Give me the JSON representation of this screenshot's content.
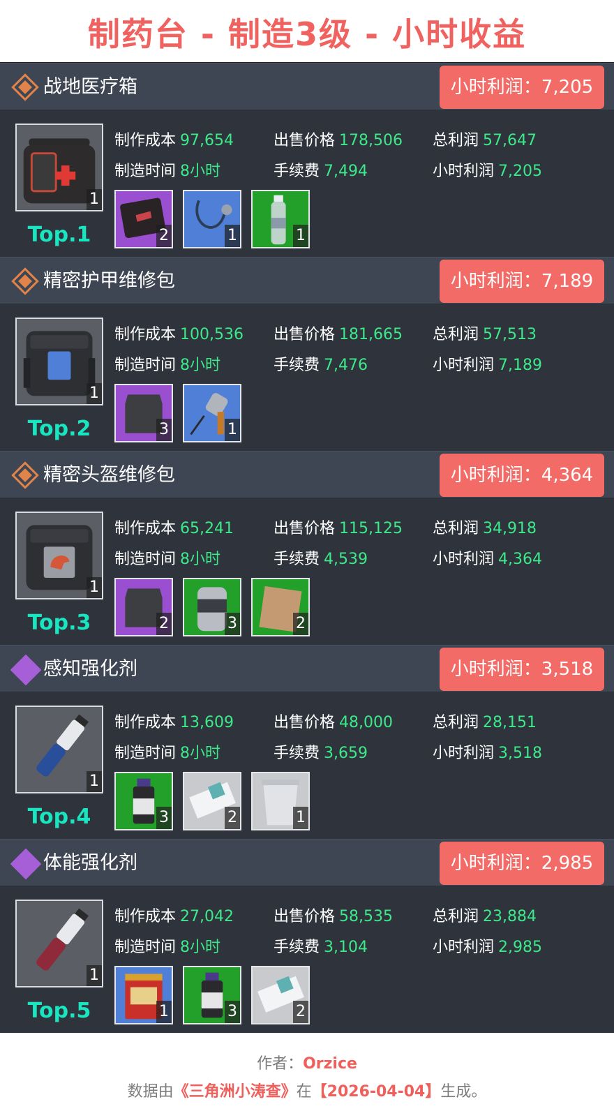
{
  "title": "制药台 - 制造3级 - 小时收益",
  "labels": {
    "cost": "制作成本",
    "time": "制造时间",
    "price": "出售价格",
    "fee": "手续费",
    "total": "总利润",
    "hourly": "小时利润"
  },
  "items": [
    {
      "name": "战地医疗箱",
      "hour_badge": "小时利润：7,205",
      "rank": "Top.1",
      "main_qty": "1",
      "cost": "97,654",
      "time": "8小时",
      "price": "178,506",
      "fee": "7,494",
      "total": "57,647",
      "hourly": "7,205",
      "materials": [
        {
          "qty": "2",
          "icon": "ifak-pouch-icon"
        },
        {
          "qty": "1",
          "icon": "stethoscope-icon"
        },
        {
          "qty": "1",
          "icon": "water-bottle-icon"
        }
      ]
    },
    {
      "name": "精密护甲维修包",
      "hour_badge": "小时利润：7,189",
      "rank": "Top.2",
      "main_qty": "1",
      "cost": "100,536",
      "time": "8小时",
      "price": "181,665",
      "fee": "7,476",
      "total": "57,513",
      "hourly": "7,189",
      "materials": [
        {
          "qty": "3",
          "icon": "armor-plate-icon"
        },
        {
          "qty": "1",
          "icon": "power-drill-icon"
        }
      ]
    },
    {
      "name": "精密头盔维修包",
      "hour_badge": "小时利润：4,364",
      "rank": "Top.3",
      "main_qty": "1",
      "cost": "65,241",
      "time": "8小时",
      "price": "115,125",
      "fee": "4,539",
      "total": "34,918",
      "hourly": "4,364",
      "materials": [
        {
          "qty": "2",
          "icon": "armor-plate-icon"
        },
        {
          "qty": "3",
          "icon": "gas-canister-icon"
        },
        {
          "qty": "2",
          "icon": "wood-plank-icon"
        }
      ]
    },
    {
      "name": "感知强化剂",
      "hour_badge": "小时利润：3,518",
      "rank": "Top.4",
      "main_qty": "1",
      "cost": "13,609",
      "time": "8小时",
      "price": "48,000",
      "fee": "3,659",
      "total": "28,151",
      "hourly": "3,518",
      "materials": [
        {
          "qty": "3",
          "icon": "medicine-vial-icon"
        },
        {
          "qty": "2",
          "icon": "test-strip-icon"
        },
        {
          "qty": "1",
          "icon": "yogurt-cup-icon"
        }
      ]
    },
    {
      "name": "体能强化剂",
      "hour_badge": "小时利润：2,985",
      "rank": "Top.5",
      "main_qty": "1",
      "cost": "27,042",
      "time": "8小时",
      "price": "58,535",
      "fee": "3,104",
      "total": "23,884",
      "hourly": "2,985",
      "materials": [
        {
          "qty": "1",
          "icon": "sweet-tea-tin-icon"
        },
        {
          "qty": "3",
          "icon": "medicine-vial-icon"
        },
        {
          "qty": "2",
          "icon": "test-strip-icon"
        }
      ]
    }
  ],
  "footer": {
    "author_label": "作者：",
    "author": "Orzice",
    "data_prefix": "数据由",
    "source": "《三角洲小涛查》",
    "data_mid": "在",
    "date": "【2026-04-04】",
    "data_suffix": "生成。"
  },
  "colors": {
    "title": "#f0625f",
    "badge": "#f26b67",
    "rank": "#19e5c0",
    "value": "#3cea8a",
    "panel": "#2f333c",
    "header": "#3e4553"
  }
}
